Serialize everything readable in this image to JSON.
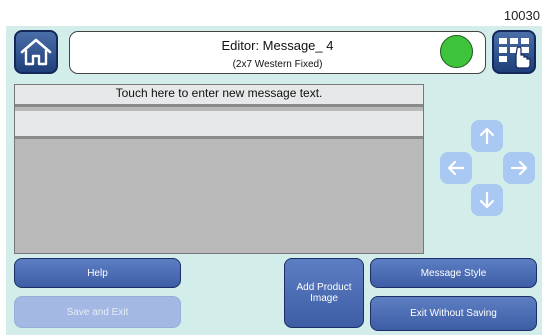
{
  "screen_id": "10030",
  "header": {
    "title": "Editor: Message_ 4",
    "subtitle": "(2x7 Western Fixed)",
    "status_color": "#3ec43a"
  },
  "editor": {
    "line1_placeholder": "Touch here to enter new message text.",
    "line2_text": ""
  },
  "nav_arrows": [
    "up-arrow-icon",
    "left-arrow-icon",
    "right-arrow-icon",
    "down-arrow-icon"
  ],
  "buttons": {
    "help": "Help",
    "save_and_exit": "Save and Exit",
    "add_product_image": "Add Product Image",
    "message_style": "Message Style",
    "exit_without_saving": "Exit Without Saving"
  },
  "colors": {
    "panel_bg": "#d3edea",
    "button_blue": "#4a6bb2",
    "button_disabled": "#a3b9e3",
    "arrow_bg": "#a9c8f2"
  }
}
